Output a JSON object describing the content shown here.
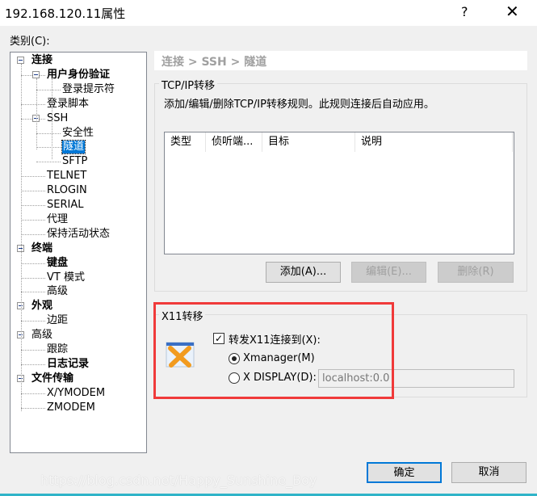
{
  "window": {
    "title": "192.168.120.11属性",
    "help": "?",
    "close": "✕"
  },
  "category_label": "类别(C):",
  "tree": [
    {
      "label": "连接",
      "level": 0,
      "bold": true,
      "expander": true
    },
    {
      "label": "用户身份验证",
      "level": 1,
      "bold": true,
      "expander": true
    },
    {
      "label": "登录提示符",
      "level": 2
    },
    {
      "label": "登录脚本",
      "level": 1
    },
    {
      "label": "SSH",
      "level": 1,
      "expander": true
    },
    {
      "label": "安全性",
      "level": 2
    },
    {
      "label": "隧道",
      "level": 2,
      "selected": true
    },
    {
      "label": "SFTP",
      "level": 2
    },
    {
      "label": "TELNET",
      "level": 1
    },
    {
      "label": "RLOGIN",
      "level": 1
    },
    {
      "label": "SERIAL",
      "level": 1
    },
    {
      "label": "代理",
      "level": 1
    },
    {
      "label": "保持活动状态",
      "level": 1
    },
    {
      "label": "终端",
      "level": 0,
      "bold": true,
      "expander": true
    },
    {
      "label": "键盘",
      "level": 1,
      "bold": true
    },
    {
      "label": "VT 模式",
      "level": 1
    },
    {
      "label": "高级",
      "level": 1
    },
    {
      "label": "外观",
      "level": 0,
      "bold": true,
      "expander": true
    },
    {
      "label": "边距",
      "level": 1
    },
    {
      "label": "高级",
      "level": 0,
      "expander": true
    },
    {
      "label": "跟踪",
      "level": 1
    },
    {
      "label": "日志记录",
      "level": 1,
      "bold": true
    },
    {
      "label": "文件传输",
      "level": 0,
      "bold": true,
      "expander": true
    },
    {
      "label": "X/YMODEM",
      "level": 1
    },
    {
      "label": "ZMODEM",
      "level": 1
    }
  ],
  "breadcrumb": "连接 > SSH > 隧道",
  "tcpip": {
    "title": "TCP/IP转移",
    "description": "添加/编辑/删除TCP/IP转移规则。此规则连接后自动应用。",
    "columns": [
      "类型",
      "侦听端...",
      "目标",
      "说明"
    ],
    "add": "添加(A)...",
    "edit": "编辑(E)...",
    "delete": "删除(R)"
  },
  "x11": {
    "title": "X11转移",
    "forward_label": "转发X11连接到(X):",
    "forward_checked": true,
    "xmanager": "Xmanager(M)",
    "xdisplay": "X DISPLAY(D):",
    "selected": "Xmanager(M)",
    "display_value": "localhost:0.0",
    "icon": "xmanager-icon"
  },
  "footer": {
    "ok": "确定",
    "cancel": "取消"
  },
  "watermark": "https://blog.csdn.net/Happy_Sunshine_Boy",
  "colors": {
    "selection": "#0078d7",
    "highlight_box": "#f03a3a",
    "focus": "#0078d7"
  }
}
